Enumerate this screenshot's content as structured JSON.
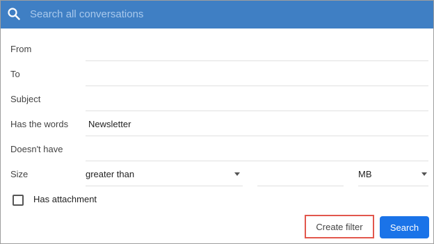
{
  "search": {
    "placeholder": "Search all conversations",
    "icon": "search-icon"
  },
  "fields": [
    {
      "label": "From",
      "value": ""
    },
    {
      "label": "To",
      "value": ""
    },
    {
      "label": "Subject",
      "value": ""
    },
    {
      "label": "Has the words",
      "value": "Newsletter"
    },
    {
      "label": "Doesn't have",
      "value": ""
    }
  ],
  "size": {
    "label": "Size",
    "comparison": "greater than",
    "number": "",
    "unit": "MB"
  },
  "attachment": {
    "label": "Has attachment",
    "checked": false
  },
  "actions": {
    "create_filter": "Create filter",
    "search": "Search"
  },
  "colors": {
    "search_bar": "#3f7fc4",
    "primary_button": "#1a73e8",
    "highlight_border": "#e2574c"
  }
}
